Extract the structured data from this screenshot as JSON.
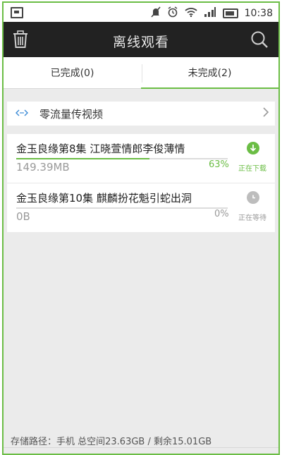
{
  "statusbar": {
    "time": "10:38",
    "icons": [
      "screenshot-icon",
      "mute-icon",
      "alarm-icon",
      "wifi-icon",
      "signal-icon",
      "battery-icon"
    ]
  },
  "header": {
    "title": "离线观看",
    "left_icon": "trash-icon",
    "right_icon": "search-icon"
  },
  "tabs": [
    {
      "label": "已完成(0)",
      "active": false
    },
    {
      "label": "未完成(2)",
      "active": true
    }
  ],
  "zero_traffic": {
    "icon": "zero-traffic-icon",
    "label": "零流量传视频"
  },
  "downloads": [
    {
      "title": "金玉良缘第8集  江晓萱情郎李俊薄情",
      "size": "149.39MB",
      "percent_text": "63%",
      "progress": 0.63,
      "status": "正在下载",
      "status_icon": "download-arrow-icon"
    },
    {
      "title": "金玉良缘第10集  麒麟扮花魁引蛇出洞",
      "size": "0B",
      "percent_text": "0%",
      "progress": 0.0,
      "status": "正在等待",
      "status_icon": "clock-icon"
    }
  ],
  "storage_info": "存储路径：手机 总空间23.63GB / 剩余15.01GB",
  "colors": {
    "accent": "#6bbd45",
    "titlebar_bg": "#222222",
    "background": "#ebebeb",
    "waiting_gray": "#9a9a9a",
    "link_blue": "#3a8ad6"
  }
}
